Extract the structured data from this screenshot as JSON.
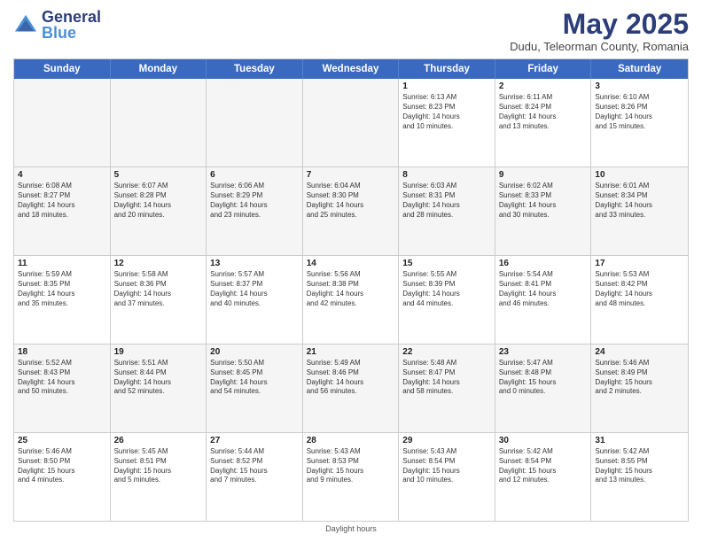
{
  "logo": {
    "line1": "General",
    "line2": "Blue"
  },
  "title": "May 2025",
  "subtitle": "Dudu, Teleorman County, Romania",
  "header_days": [
    "Sunday",
    "Monday",
    "Tuesday",
    "Wednesday",
    "Thursday",
    "Friday",
    "Saturday"
  ],
  "footer": "Daylight hours",
  "rows": [
    [
      {
        "day": "",
        "text": "",
        "empty": true
      },
      {
        "day": "",
        "text": "",
        "empty": true
      },
      {
        "day": "",
        "text": "",
        "empty": true
      },
      {
        "day": "",
        "text": "",
        "empty": true
      },
      {
        "day": "1",
        "text": "Sunrise: 6:13 AM\nSunset: 8:23 PM\nDaylight: 14 hours\nand 10 minutes."
      },
      {
        "day": "2",
        "text": "Sunrise: 6:11 AM\nSunset: 8:24 PM\nDaylight: 14 hours\nand 13 minutes."
      },
      {
        "day": "3",
        "text": "Sunrise: 6:10 AM\nSunset: 8:26 PM\nDaylight: 14 hours\nand 15 minutes."
      }
    ],
    [
      {
        "day": "4",
        "text": "Sunrise: 6:08 AM\nSunset: 8:27 PM\nDaylight: 14 hours\nand 18 minutes."
      },
      {
        "day": "5",
        "text": "Sunrise: 6:07 AM\nSunset: 8:28 PM\nDaylight: 14 hours\nand 20 minutes."
      },
      {
        "day": "6",
        "text": "Sunrise: 6:06 AM\nSunset: 8:29 PM\nDaylight: 14 hours\nand 23 minutes."
      },
      {
        "day": "7",
        "text": "Sunrise: 6:04 AM\nSunset: 8:30 PM\nDaylight: 14 hours\nand 25 minutes."
      },
      {
        "day": "8",
        "text": "Sunrise: 6:03 AM\nSunset: 8:31 PM\nDaylight: 14 hours\nand 28 minutes."
      },
      {
        "day": "9",
        "text": "Sunrise: 6:02 AM\nSunset: 8:33 PM\nDaylight: 14 hours\nand 30 minutes."
      },
      {
        "day": "10",
        "text": "Sunrise: 6:01 AM\nSunset: 8:34 PM\nDaylight: 14 hours\nand 33 minutes."
      }
    ],
    [
      {
        "day": "11",
        "text": "Sunrise: 5:59 AM\nSunset: 8:35 PM\nDaylight: 14 hours\nand 35 minutes."
      },
      {
        "day": "12",
        "text": "Sunrise: 5:58 AM\nSunset: 8:36 PM\nDaylight: 14 hours\nand 37 minutes."
      },
      {
        "day": "13",
        "text": "Sunrise: 5:57 AM\nSunset: 8:37 PM\nDaylight: 14 hours\nand 40 minutes."
      },
      {
        "day": "14",
        "text": "Sunrise: 5:56 AM\nSunset: 8:38 PM\nDaylight: 14 hours\nand 42 minutes."
      },
      {
        "day": "15",
        "text": "Sunrise: 5:55 AM\nSunset: 8:39 PM\nDaylight: 14 hours\nand 44 minutes."
      },
      {
        "day": "16",
        "text": "Sunrise: 5:54 AM\nSunset: 8:41 PM\nDaylight: 14 hours\nand 46 minutes."
      },
      {
        "day": "17",
        "text": "Sunrise: 5:53 AM\nSunset: 8:42 PM\nDaylight: 14 hours\nand 48 minutes."
      }
    ],
    [
      {
        "day": "18",
        "text": "Sunrise: 5:52 AM\nSunset: 8:43 PM\nDaylight: 14 hours\nand 50 minutes."
      },
      {
        "day": "19",
        "text": "Sunrise: 5:51 AM\nSunset: 8:44 PM\nDaylight: 14 hours\nand 52 minutes."
      },
      {
        "day": "20",
        "text": "Sunrise: 5:50 AM\nSunset: 8:45 PM\nDaylight: 14 hours\nand 54 minutes."
      },
      {
        "day": "21",
        "text": "Sunrise: 5:49 AM\nSunset: 8:46 PM\nDaylight: 14 hours\nand 56 minutes."
      },
      {
        "day": "22",
        "text": "Sunrise: 5:48 AM\nSunset: 8:47 PM\nDaylight: 14 hours\nand 58 minutes."
      },
      {
        "day": "23",
        "text": "Sunrise: 5:47 AM\nSunset: 8:48 PM\nDaylight: 15 hours\nand 0 minutes."
      },
      {
        "day": "24",
        "text": "Sunrise: 5:46 AM\nSunset: 8:49 PM\nDaylight: 15 hours\nand 2 minutes."
      }
    ],
    [
      {
        "day": "25",
        "text": "Sunrise: 5:46 AM\nSunset: 8:50 PM\nDaylight: 15 hours\nand 4 minutes."
      },
      {
        "day": "26",
        "text": "Sunrise: 5:45 AM\nSunset: 8:51 PM\nDaylight: 15 hours\nand 5 minutes."
      },
      {
        "day": "27",
        "text": "Sunrise: 5:44 AM\nSunset: 8:52 PM\nDaylight: 15 hours\nand 7 minutes."
      },
      {
        "day": "28",
        "text": "Sunrise: 5:43 AM\nSunset: 8:53 PM\nDaylight: 15 hours\nand 9 minutes."
      },
      {
        "day": "29",
        "text": "Sunrise: 5:43 AM\nSunset: 8:54 PM\nDaylight: 15 hours\nand 10 minutes."
      },
      {
        "day": "30",
        "text": "Sunrise: 5:42 AM\nSunset: 8:54 PM\nDaylight: 15 hours\nand 12 minutes."
      },
      {
        "day": "31",
        "text": "Sunrise: 5:42 AM\nSunset: 8:55 PM\nDaylight: 15 hours\nand 13 minutes."
      }
    ]
  ]
}
